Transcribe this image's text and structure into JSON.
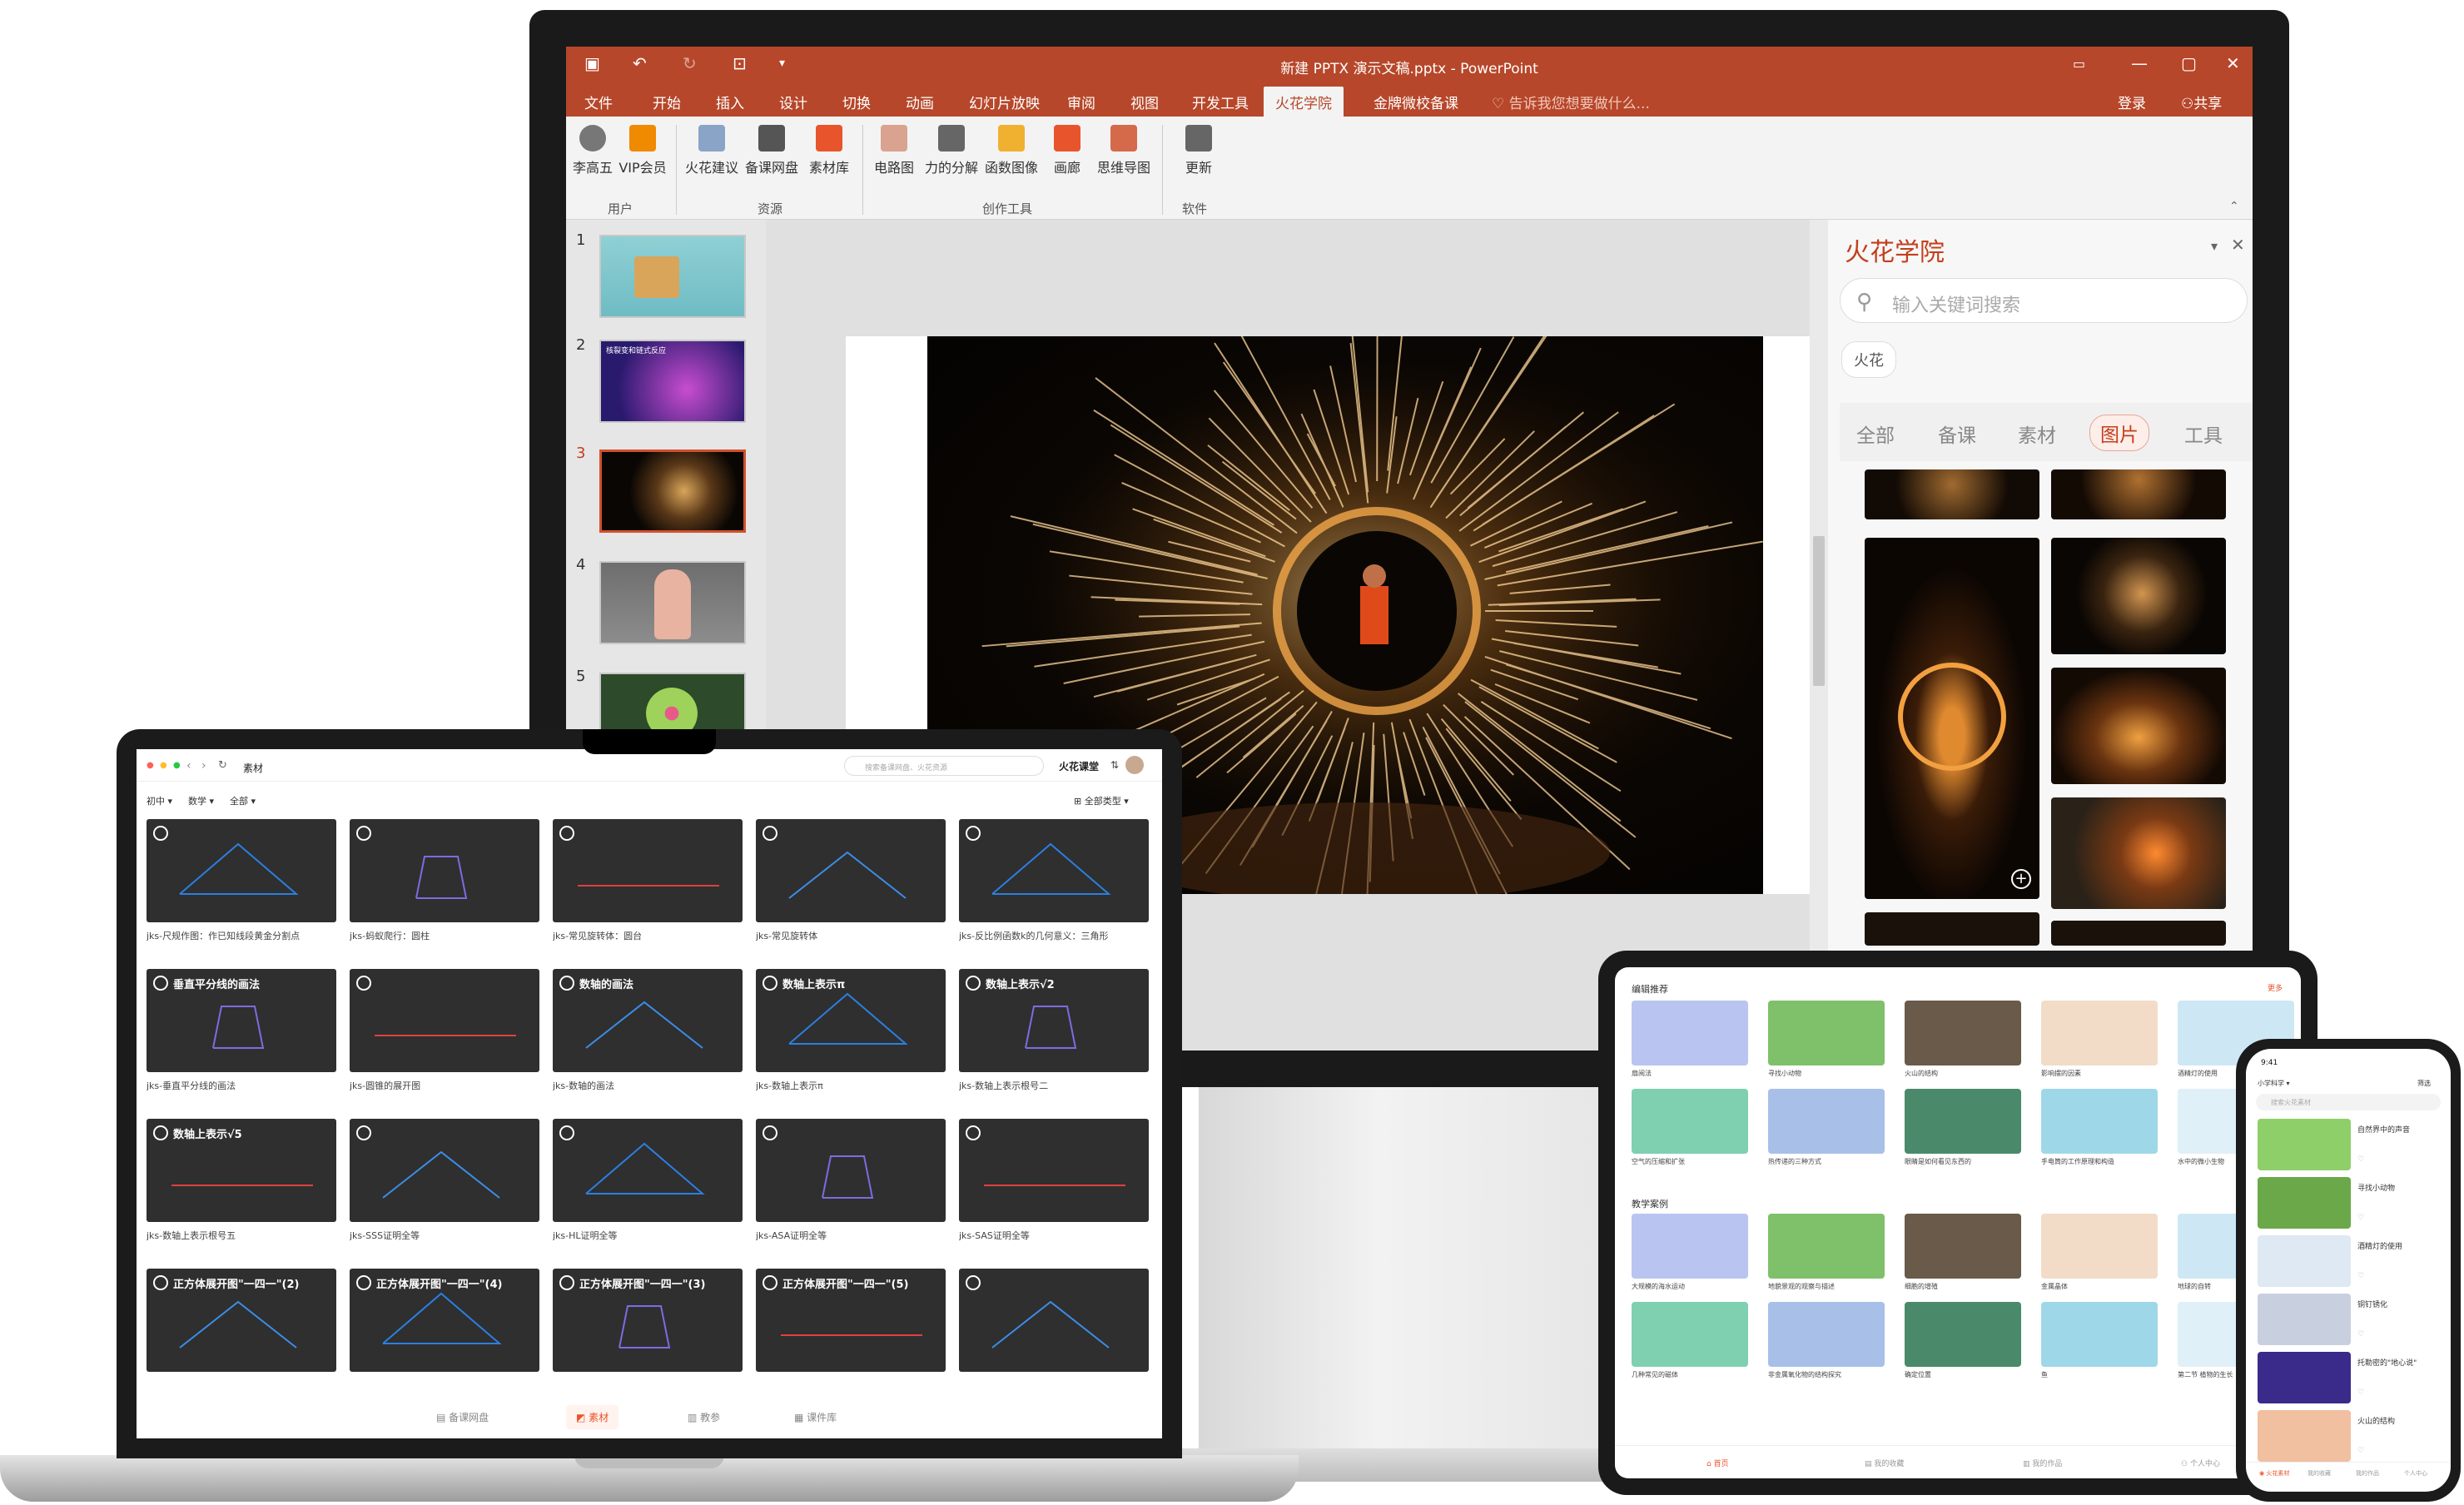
{
  "powerpoint": {
    "window_title": "新建 PPTX 演示文稿.pptx - PowerPoint",
    "tabs": [
      "文件",
      "开始",
      "插入",
      "设计",
      "切换",
      "动画",
      "幻灯片放映",
      "审阅",
      "视图",
      "开发工具",
      "火花学院",
      "金牌微校备课"
    ],
    "active_tab": "火花学院",
    "tell_me": "告诉我您想要做什么...",
    "login": "登录",
    "share": "共享",
    "ribbon_buttons": [
      "李高五",
      "VIP会员",
      "火花建议",
      "备课网盘",
      "素材库",
      "电路图",
      "力的分解",
      "函数图像",
      "画廊",
      "思维导图",
      "更新"
    ],
    "ribbon_groups": [
      "用户",
      "资源",
      "创作工具",
      "软件"
    ],
    "slide_numbers": [
      "1",
      "2",
      "3",
      "4",
      "5"
    ],
    "slide2_title": "核裂变和链式反应",
    "active_slide": 3
  },
  "side_pane": {
    "title": "火花学院",
    "search_placeholder": "输入关键词搜索",
    "tag": "火花",
    "tabs": [
      "全部",
      "备课",
      "素材",
      "图片",
      "工具"
    ],
    "active_tab": "图片"
  },
  "laptop": {
    "page_title": "素材",
    "search_placeholder": "搜索备课网盘、火花资源",
    "brand": "火花课堂",
    "filters": [
      "初中",
      "数学",
      "全部"
    ],
    "type_filter": "全部类型",
    "cards": [
      {
        "title": "",
        "caption": "jks-尺规作图：作已知线段黄金分割点"
      },
      {
        "title": "",
        "caption": "jks-蚂蚁爬行：圆柱"
      },
      {
        "title": "",
        "caption": "jks-常见旋转体：圆台"
      },
      {
        "title": "",
        "caption": "jks-常见旋转体"
      },
      {
        "title": "",
        "caption": "jks-反比例函数k的几何意义：三角形"
      },
      {
        "title": "垂直平分线的画法",
        "caption": "jks-垂直平分线的画法"
      },
      {
        "title": "",
        "caption": "jks-圆锥的展开图"
      },
      {
        "title": "数轴的画法",
        "caption": "jks-数轴的画法"
      },
      {
        "title": "数轴上表示π",
        "caption": "jks-数轴上表示π"
      },
      {
        "title": "数轴上表示√2",
        "caption": "jks-数轴上表示根号二"
      },
      {
        "title": "数轴上表示√5",
        "caption": "jks-数轴上表示根号五"
      },
      {
        "title": "",
        "caption": "jks-SSS证明全等"
      },
      {
        "title": "",
        "caption": "jks-HL证明全等"
      },
      {
        "title": "",
        "caption": "jks-ASA证明全等"
      },
      {
        "title": "",
        "caption": "jks-SAS证明全等"
      },
      {
        "title": "正方体展开图\"一四一\"(2)",
        "caption": ""
      },
      {
        "title": "正方体展开图\"一四一\"(4)",
        "caption": ""
      },
      {
        "title": "正方体展开图\"一四一\"(3)",
        "caption": ""
      },
      {
        "title": "正方体展开图\"一四一\"(5)",
        "caption": ""
      },
      {
        "title": "",
        "caption": ""
      }
    ],
    "bottom_nav": [
      "备课网盘",
      "素材",
      "教参",
      "课件库"
    ],
    "bottom_nav_active": "素材"
  },
  "tablet": {
    "section1": "编辑推荐",
    "more": "更多",
    "row1": [
      "扇阅法",
      "寻找小动物",
      "火山的结构",
      "影响摆的因素",
      "酒精灯的使用"
    ],
    "row2": [
      "空气的压缩和扩张",
      "热传递的三种方式",
      "眼睛是如何看见东西的",
      "手电筒的工作原理和构造",
      "水中的微小生物"
    ],
    "section2": "教学案例",
    "row3": [
      "大规模的海水运动",
      "地貌景观的观察与描述",
      "细胞的增殖",
      "金属晶体",
      "地球的自转"
    ],
    "row4": [
      "几种常见的磁体",
      "非金属氧化物的结构探究",
      "确定位置",
      "鱼",
      "第二节 植物的生长"
    ],
    "nav": [
      "首页",
      "我的收藏",
      "我的作品",
      "个人中心"
    ]
  },
  "phone": {
    "time": "9:41",
    "grade": "小学科学",
    "filter": "筛选",
    "search_placeholder": "搜索火花素材",
    "items": [
      "自然界中的声音",
      "寻找小动物",
      "酒精灯的使用",
      "铜钉锈化",
      "托勒密的\"地心说\"",
      "火山的结构"
    ],
    "nav": [
      "火花素材",
      "我的收藏",
      "我的作品",
      "个人中心"
    ]
  }
}
